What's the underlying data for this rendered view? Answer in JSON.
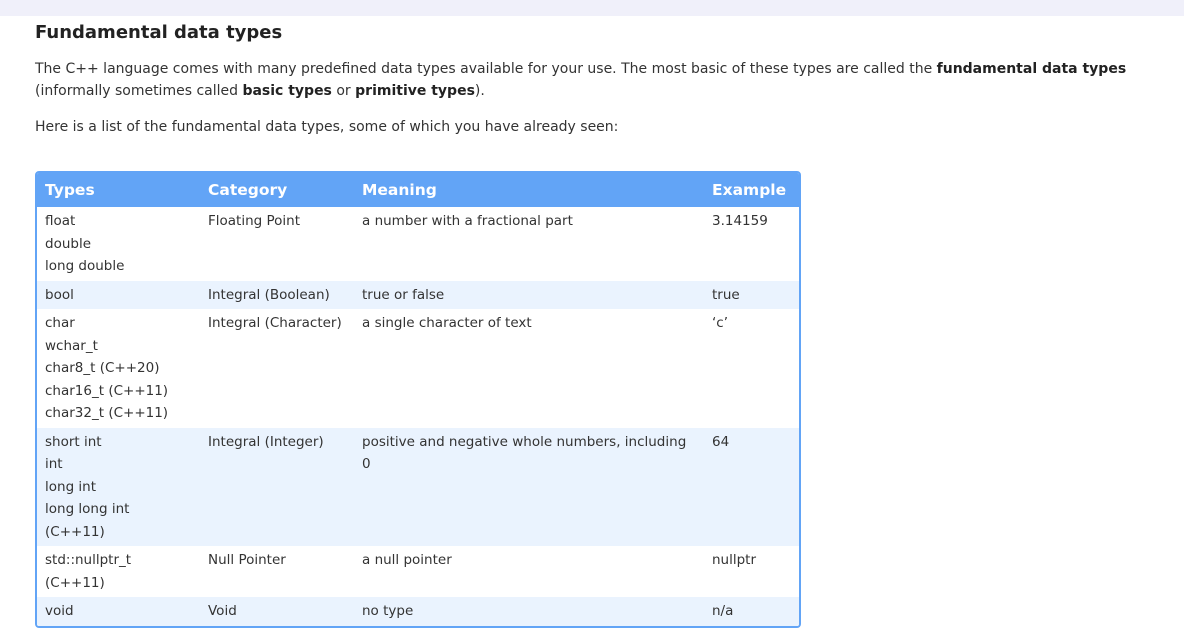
{
  "heading": "Fundamental data types",
  "intro": {
    "part1": "The C++ language comes with many predefined data types available for your use. The most basic of these types are called the ",
    "bold1": "fundamental data types",
    "part2": " (informally sometimes called ",
    "bold2": "basic types",
    "part3": " or ",
    "bold3": "primitive types",
    "part4": ")."
  },
  "list_intro": "Here is a list of the fundamental data types, some of which you have already seen:",
  "table": {
    "headers": [
      "Types",
      "Category",
      "Meaning",
      "Example"
    ],
    "rows": [
      {
        "types": [
          "float",
          "double",
          "long double"
        ],
        "category": "Floating Point",
        "meaning": "a number with a fractional part",
        "example": "3.14159"
      },
      {
        "types": [
          "bool"
        ],
        "category": "Integral (Boolean)",
        "meaning": "true or false",
        "example": "true"
      },
      {
        "types": [
          "char",
          "wchar_t",
          "char8_t (C++20)",
          "char16_t (C++11)",
          "char32_t (C++11)"
        ],
        "category": "Integral (Character)",
        "meaning": "a single character of text",
        "example": "‘c’"
      },
      {
        "types": [
          "short int",
          "int",
          "long int",
          "long long int (C++11)"
        ],
        "category": "Integral (Integer)",
        "meaning": "positive and negative whole numbers, including 0",
        "example": "64"
      },
      {
        "types": [
          "std::nullptr_t (C++11)"
        ],
        "category": "Null Pointer",
        "meaning": "a null pointer",
        "example": "nullptr"
      },
      {
        "types": [
          "void"
        ],
        "category": "Void",
        "meaning": "no type",
        "example": "n/a"
      }
    ]
  },
  "colors": {
    "header_bg": "#62a4f6",
    "alt_row_bg": "#eaf3fe",
    "top_bar": "#f0f0fa"
  }
}
